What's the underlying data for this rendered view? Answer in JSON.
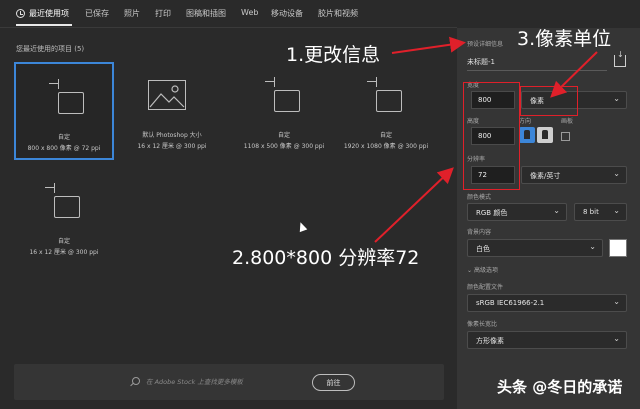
{
  "tabs": [
    {
      "label": "最近使用项"
    },
    {
      "label": "已保存"
    },
    {
      "label": "照片"
    },
    {
      "label": "打印"
    },
    {
      "label": "图稿和插图"
    },
    {
      "label": "Web"
    },
    {
      "label": "移动设备"
    },
    {
      "label": "胶片和视频"
    }
  ],
  "recent": {
    "title": "您最近使用的项目 (5)",
    "items": [
      {
        "name": "自定",
        "detail": "800 x 800 像素 @ 72 ppi",
        "icon": "doc-icon"
      },
      {
        "name": "默认 Photoshop 大小",
        "detail": "16 x 12 厘米 @ 300 ppi",
        "icon": "image-icon"
      },
      {
        "name": "自定",
        "detail": "1108 x 500 像素 @ 300 ppi",
        "icon": "doc-icon"
      },
      {
        "name": "自定",
        "detail": "1920 x 1080 像素 @ 300 ppi",
        "icon": "doc-icon"
      },
      {
        "name": "自定",
        "detail": "16 x 12 厘米 @ 300 ppi",
        "icon": "doc-icon"
      }
    ]
  },
  "search": {
    "placeholder": "在 Adobe Stock 上查找更多模板",
    "go_label": "前往"
  },
  "panel": {
    "section_title": "预设详细信息",
    "doc_name": "未标题-1",
    "width_label": "宽度",
    "width_value": "800",
    "width_unit": "像素",
    "height_label": "高度",
    "height_value": "800",
    "orientation_label": "方向",
    "artboard_label": "画板",
    "resolution_label": "分辨率",
    "resolution_value": "72",
    "resolution_unit": "像素/英寸",
    "color_mode_label": "颜色模式",
    "color_mode_value": "RGB 颜色",
    "bit_depth": "8 bit",
    "background_label": "背景内容",
    "background_value": "白色",
    "background_color": "#ffffff",
    "advanced_label": "高级选项",
    "profile_label": "颜色配置文件",
    "profile_value": "sRGB IEC61966-2.1",
    "pixel_aspect_label": "像素长宽比",
    "pixel_aspect_value": "方形像素"
  },
  "annotations": {
    "note1": "1.更改信息",
    "note2": "2.800*800 分辨率72",
    "note3": "3.像素单位",
    "color": "#e0202a"
  },
  "watermark": "头条 @冬日的承诺"
}
